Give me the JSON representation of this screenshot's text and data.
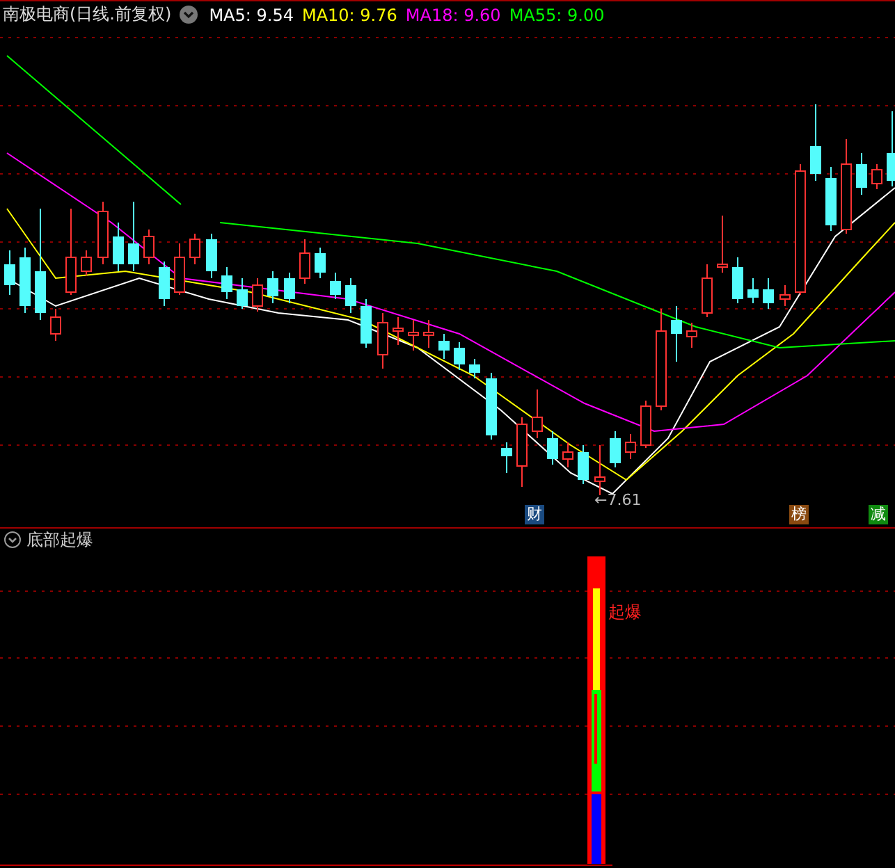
{
  "title": "南极电商(日线.前复权)",
  "ma_legend": [
    {
      "label": "MA5: 9.54",
      "color": "#ffffff"
    },
    {
      "label": "MA10: 9.76",
      "color": "#ffff00"
    },
    {
      "label": "MA18: 9.60",
      "color": "#ff00ff"
    },
    {
      "label": "MA55: 9.00",
      "color": "#00ff00"
    }
  ],
  "low_marker": "←7.61",
  "event_badges": [
    {
      "label": "财",
      "color": "#1a4a80"
    },
    {
      "label": "榜",
      "color": "#8a4a10"
    },
    {
      "label": "减",
      "color": "#108a10"
    }
  ],
  "indicator": {
    "title": "底部起爆",
    "signal_label": "起爆"
  }
}
